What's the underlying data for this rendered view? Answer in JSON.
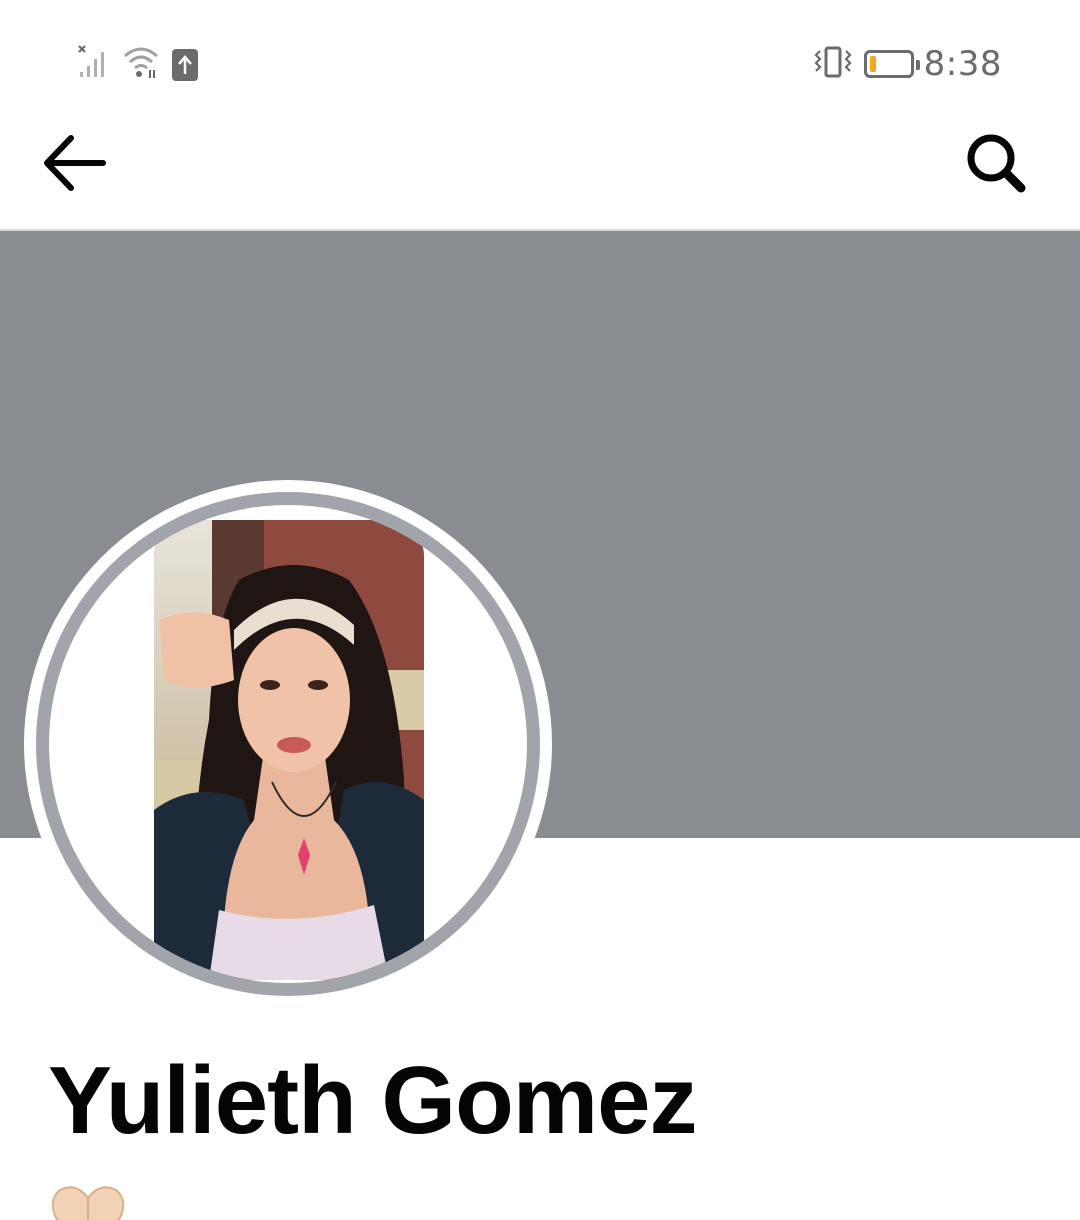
{
  "status_bar": {
    "time": "8:38",
    "icons": [
      "signal-off-icon",
      "wifi-icon",
      "upload-icon",
      "vibrate-icon",
      "battery-low-icon"
    ],
    "battery_level": 0.15,
    "battery_color": "#f5a623"
  },
  "app_bar": {
    "back_icon": "arrow-left-icon",
    "search_icon": "search-icon"
  },
  "profile": {
    "name": "Yulieth Gomez",
    "cover_color": "#898c90",
    "ring_color": "#a1a5ab",
    "bio_emoji": "heart-hands-emoji"
  }
}
